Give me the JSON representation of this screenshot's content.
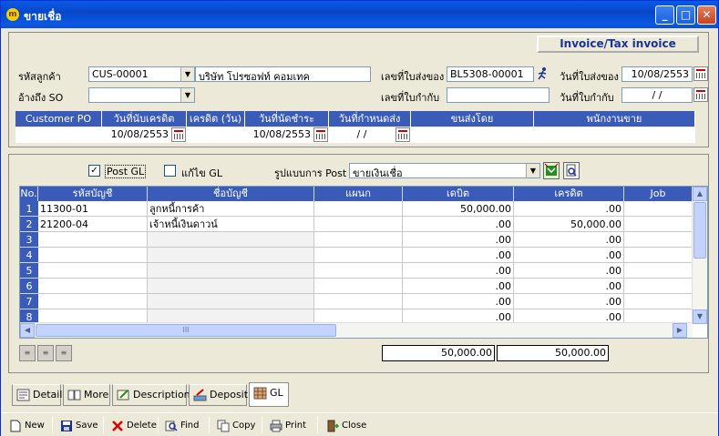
{
  "window": {
    "title": "ขายเชื่อ",
    "icon_glyph": "m"
  },
  "header": {
    "doc_type": "Invoice/Tax invoice",
    "customer_label": "รหัสลูกค้า",
    "customer_code": "CUS-00001",
    "customer_name": "บริษัท โปรซอฟท์ คอมเทค",
    "so_label": "อ้างถึง SO",
    "so_value": "",
    "delivery_no_label": "เลขที่ใบส่งของ",
    "delivery_no": "BL5308-00001",
    "delivery_date_label": "วันที่ใบส่งของ",
    "delivery_date": "10/08/2553",
    "tax_no_label": "เลขที่ใบกำกับ",
    "tax_no": "",
    "tax_date_label": "วันที่ใบกำกับ",
    "tax_date": "/ /"
  },
  "terms": {
    "headers": [
      "Customer PO",
      "วันที่นับเครดิต",
      "เครดิต (วัน)",
      "วันที่นัดชำระ",
      "วันที่กำหนดส่ง",
      "ขนส่งโดย",
      "พนักงานขาย"
    ],
    "values": [
      "",
      "10/08/2553",
      "",
      "10/08/2553",
      "/ /",
      "",
      ""
    ]
  },
  "gl": {
    "post_gl_label": "Post GL",
    "post_gl_checked": true,
    "edit_gl_label": "แก้ไข GL",
    "edit_gl_checked": false,
    "post_format_label": "รูปแบบการ Post",
    "post_format_value": "ขายเงินเชื่อ",
    "columns": [
      "No.",
      "รหัสบัญชี",
      "ชื่อบัญชี",
      "แผนก",
      "เดบิต",
      "เครดิต",
      "Job"
    ],
    "rows": [
      {
        "no": "1",
        "code": "11300-01",
        "name": "ลูกหนี้การค้า",
        "dept": "",
        "debit": "50,000.00",
        "credit": ".00",
        "job": ""
      },
      {
        "no": "2",
        "code": "21200-04",
        "name": "เจ้าหนี้เงินดาวน์",
        "dept": "",
        "debit": ".00",
        "credit": "50,000.00",
        "job": ""
      },
      {
        "no": "3",
        "code": "",
        "name": "",
        "dept": "",
        "debit": ".00",
        "credit": ".00",
        "job": ""
      },
      {
        "no": "4",
        "code": "",
        "name": "",
        "dept": "",
        "debit": ".00",
        "credit": ".00",
        "job": ""
      },
      {
        "no": "5",
        "code": "",
        "name": "",
        "dept": "",
        "debit": ".00",
        "credit": ".00",
        "job": ""
      },
      {
        "no": "6",
        "code": "",
        "name": "",
        "dept": "",
        "debit": ".00",
        "credit": ".00",
        "job": ""
      },
      {
        "no": "7",
        "code": "",
        "name": "",
        "dept": "",
        "debit": ".00",
        "credit": ".00",
        "job": ""
      },
      {
        "no": "8",
        "code": "",
        "name": "",
        "dept": "",
        "debit": ".00",
        "credit": ".00",
        "job": ""
      }
    ],
    "total_debit": "50,000.00",
    "total_credit": "50,000.00",
    "scroll_glyph": "III"
  },
  "tabs": [
    {
      "label": "Detail",
      "icon": "detail-icon"
    },
    {
      "label": "More",
      "icon": "more-icon"
    },
    {
      "label": "Description",
      "icon": "description-icon"
    },
    {
      "label": "Deposit",
      "icon": "deposit-icon"
    },
    {
      "label": "GL",
      "icon": "gl-icon"
    }
  ],
  "toolbar": {
    "new": "New",
    "save": "Save",
    "delete": "Delete",
    "find": "Find",
    "copy": "Copy",
    "print": "Print",
    "close": "Close"
  },
  "colors": {
    "header_blue": "#3a5cb8",
    "title_blue": "#0a5be6",
    "invoice_text": "#1a3399"
  }
}
